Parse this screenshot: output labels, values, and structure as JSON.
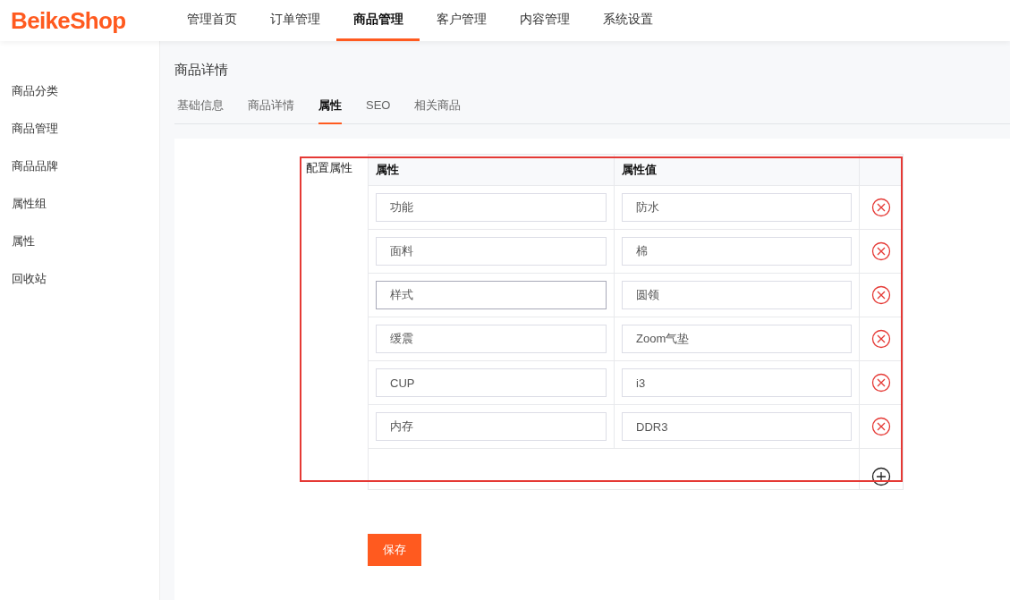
{
  "logo": "BeikeShop",
  "nav": [
    {
      "label": "管理首页",
      "selected": false
    },
    {
      "label": "订单管理",
      "selected": false
    },
    {
      "label": "商品管理",
      "selected": true
    },
    {
      "label": "客户管理",
      "selected": false
    },
    {
      "label": "内容管理",
      "selected": false
    },
    {
      "label": "系统设置",
      "selected": false
    }
  ],
  "sidebar": {
    "items": [
      {
        "label": "商品分类"
      },
      {
        "label": "商品管理"
      },
      {
        "label": "商品品牌"
      },
      {
        "label": "属性组"
      },
      {
        "label": "属性"
      },
      {
        "label": "回收站"
      }
    ]
  },
  "page_title": "商品详情",
  "tabs": [
    {
      "label": "基础信息",
      "selected": false
    },
    {
      "label": "商品详情",
      "selected": false
    },
    {
      "label": "属性",
      "selected": true
    },
    {
      "label": "SEO",
      "selected": false
    },
    {
      "label": "相关商品",
      "selected": false
    }
  ],
  "form": {
    "label": "配置属性",
    "columns": [
      "属性",
      "属性值"
    ],
    "rows": [
      {
        "attribute": "功能",
        "value": "防水",
        "focused": false
      },
      {
        "attribute": "面料",
        "value": "棉",
        "focused": false
      },
      {
        "attribute": "样式",
        "value": "圆领",
        "focused": true
      },
      {
        "attribute": "缓震",
        "value": "Zoom气垫",
        "focused": false
      },
      {
        "attribute": "CUP",
        "value": "i3",
        "focused": false
      },
      {
        "attribute": "内存",
        "value": "DDR3",
        "focused": false
      }
    ]
  },
  "save_button": "保存"
}
